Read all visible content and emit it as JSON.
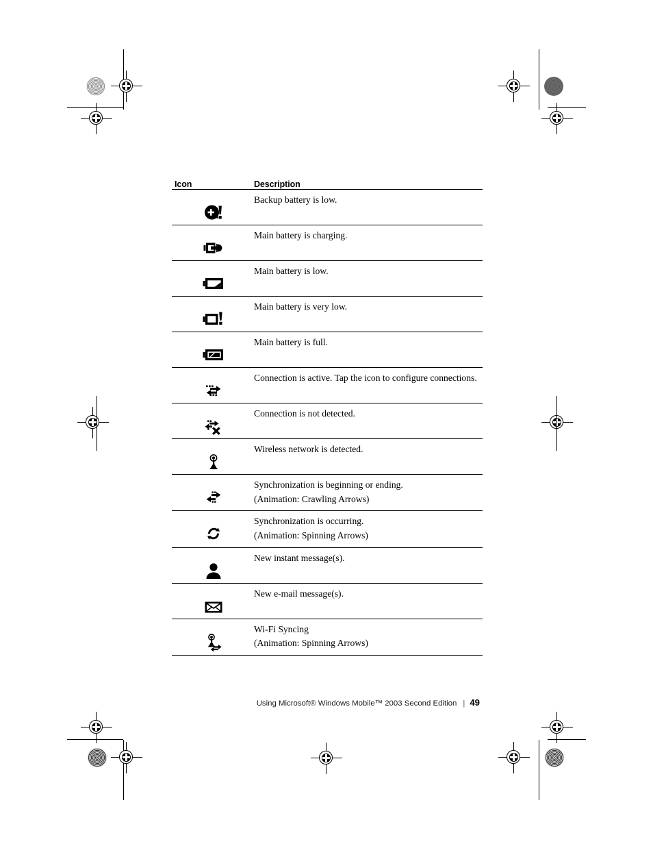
{
  "page": {
    "footer_text": "Using Microsoft® Windows Mobile™ 2003 Second Edition",
    "footer_separator": "|",
    "page_number": "49"
  },
  "table": {
    "headers": {
      "icon": "Icon",
      "description": "Description"
    },
    "rows": [
      {
        "icon_name": "backup-battery-low-icon",
        "description": "Backup battery is low.",
        "note": ""
      },
      {
        "icon_name": "main-battery-charging-icon",
        "description": "Main battery is charging.",
        "note": ""
      },
      {
        "icon_name": "main-battery-low-icon",
        "description": "Main battery is low.",
        "note": ""
      },
      {
        "icon_name": "main-battery-very-low-icon",
        "description": "Main battery is very low.",
        "note": ""
      },
      {
        "icon_name": "main-battery-full-icon",
        "description": "Main battery is full.",
        "note": ""
      },
      {
        "icon_name": "connection-active-icon",
        "description": "Connection is active. Tap the icon to configure connections.",
        "note": ""
      },
      {
        "icon_name": "connection-not-detected-icon",
        "description": "Connection is not detected.",
        "note": ""
      },
      {
        "icon_name": "wireless-network-detected-icon",
        "description": "Wireless network is detected.",
        "note": ""
      },
      {
        "icon_name": "sync-beginning-ending-icon",
        "description": "Synchronization is beginning or ending.",
        "note": "(Animation: Crawling Arrows)"
      },
      {
        "icon_name": "sync-occurring-icon",
        "description": "Synchronization is occurring.",
        "note": "(Animation: Spinning Arrows)"
      },
      {
        "icon_name": "new-instant-message-icon",
        "description": "New instant message(s).",
        "note": ""
      },
      {
        "icon_name": "new-email-message-icon",
        "description": "New e-mail message(s).",
        "note": ""
      },
      {
        "icon_name": "wifi-syncing-icon",
        "description": "Wi-Fi Syncing",
        "note": "(Animation: Spinning Arrows)"
      }
    ]
  },
  "print_marks": {
    "registration_mark_name": "registration-target-mark",
    "halftone_mark_name": "halftone-density-patch",
    "trim_mark_name": "trim-line-mark"
  }
}
